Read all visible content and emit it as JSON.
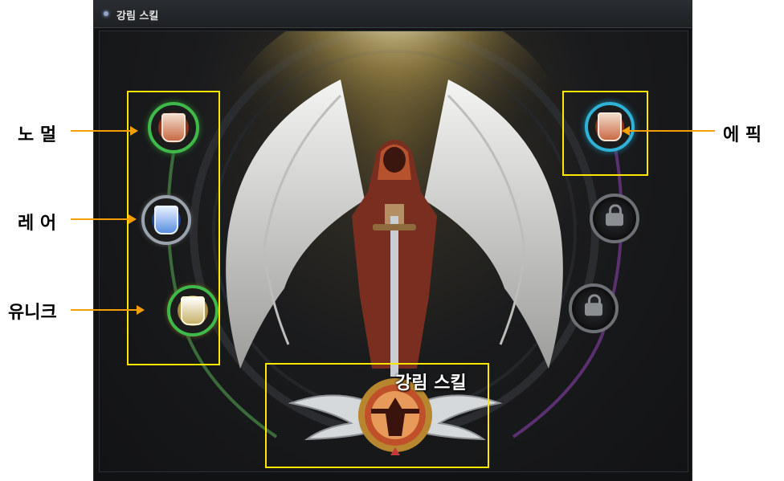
{
  "window": {
    "title": "강림 스킬"
  },
  "skills": {
    "normal": {
      "grade": "노멀",
      "icon": "crest-shield-icon"
    },
    "rare": {
      "grade": "레어",
      "icon": "crest-shield-icon"
    },
    "unique": {
      "grade": "유니크",
      "icon": "crest-shield-icon"
    },
    "epic": {
      "grade": "에픽",
      "icon": "crest-shield-icon"
    },
    "locked": [
      {
        "icon": "lock-icon"
      },
      {
        "icon": "lock-icon"
      }
    ],
    "main": {
      "label": "강림 스킬",
      "icon": "winged-emblem-icon"
    }
  },
  "annotations": {
    "normal": "노 멀",
    "rare": "레 어",
    "unique": "유니크",
    "epic": "에 픽",
    "main": "강림 스킬"
  },
  "colors": {
    "annotation_box": "#ffe600",
    "annotation_arrow": "#f5a000",
    "normal_ring": "#3fb94a",
    "rare_ring": "#9aa3ad",
    "epic_ring": "#2fb2d6"
  }
}
